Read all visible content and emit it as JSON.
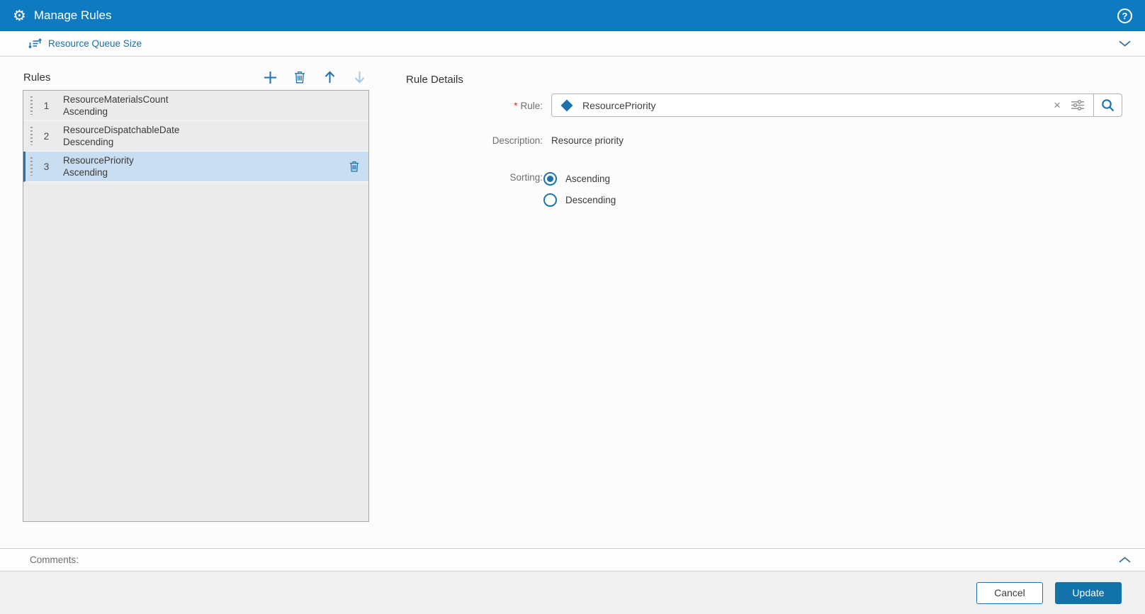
{
  "header": {
    "title": "Manage Rules"
  },
  "subheader": {
    "title": "Resource Queue Size"
  },
  "rules_panel": {
    "title": "Rules",
    "items": [
      {
        "position": "1",
        "name": "ResourceMaterialsCount",
        "direction": "Ascending",
        "selected": false
      },
      {
        "position": "2",
        "name": "ResourceDispatchableDate",
        "direction": "Descending",
        "selected": false
      },
      {
        "position": "3",
        "name": "ResourcePriority",
        "direction": "Ascending",
        "selected": true
      }
    ]
  },
  "rule_details": {
    "title": "Rule Details",
    "required_marker": "*",
    "rule_label": "Rule:",
    "rule_value": "ResourcePriority",
    "clear_glyph": "×",
    "description_label": "Description:",
    "description_value": "Resource priority",
    "sorting_label": "Sorting:",
    "sorting_options": [
      {
        "label": "Ascending",
        "selected": true
      },
      {
        "label": "Descending",
        "selected": false
      }
    ]
  },
  "comments": {
    "label": "Comments:"
  },
  "footer": {
    "cancel": "Cancel",
    "update": "Update"
  },
  "icons": {
    "app": "gear",
    "help": "question-circle",
    "section": "sort-order",
    "add": "plus",
    "delete": "trash",
    "move_up": "arrow-up",
    "move_down": "arrow-down",
    "drag": "grip-dots",
    "rule_type": "diamond",
    "clear": "x",
    "filter": "sliders",
    "search": "magnifier",
    "expand": "chevron-down",
    "collapse": "chevron-up"
  },
  "colors": {
    "header_bg": "#0e7bc0",
    "accent": "#1d72ae",
    "link": "#1d6fa8",
    "selected_row_bg": "#c9def1",
    "selected_row_border": "#2173b4",
    "list_bg": "#ebebeb",
    "update_bg": "#1173a8",
    "required": "#b03a2e",
    "disabled_icon": "#a9c8e2"
  }
}
